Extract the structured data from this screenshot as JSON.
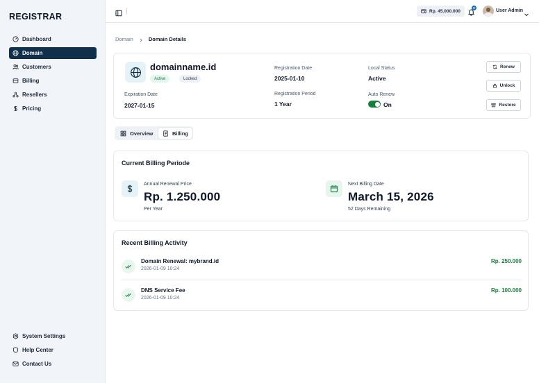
{
  "sidebar": {
    "brand": "REGISTRAR",
    "items": [
      {
        "label": "Dashboard",
        "icon": "gauge-icon"
      },
      {
        "label": "Domain",
        "icon": "globe-icon",
        "active": true
      },
      {
        "label": "Customers",
        "icon": "users-icon"
      },
      {
        "label": "Billing",
        "icon": "receipt-icon"
      },
      {
        "label": "Resellers",
        "icon": "network-icon"
      },
      {
        "label": "Pricing",
        "icon": "dollar-icon"
      }
    ],
    "bottom_items": [
      {
        "label": "System Settings",
        "icon": "gear-icon"
      },
      {
        "label": "Help Center",
        "icon": "shield-icon"
      },
      {
        "label": "Contact Us",
        "icon": "mail-icon"
      }
    ]
  },
  "topbar": {
    "balance": "Rp. 45.000.000",
    "notification_count": "0",
    "user_name": "User Admin"
  },
  "breadcrumb": {
    "parent": "Domain",
    "current": "Domain Details"
  },
  "domain": {
    "name": "domainname.id",
    "badges": [
      "Active",
      "Locked"
    ],
    "expiration_label": "Expiration Date",
    "expiration_value": "2027-01-15",
    "registration_date_label": "Registration Date",
    "registration_date_value": "2025-01-10",
    "registration_period_label": "Registration Period",
    "registration_period_value": "1 Year",
    "local_status_label": "Local Status",
    "local_status_value": "Active",
    "auto_renew_label": "Auto Renew",
    "auto_renew_value": "On",
    "actions": {
      "renew": "Renew",
      "unlock": "Unlock",
      "restore": "Restore"
    }
  },
  "tabs": [
    {
      "label": "Overview",
      "active": false
    },
    {
      "label": "Billing",
      "active": true
    }
  ],
  "billing_period": {
    "title": "Current Billing Periode",
    "renewal_label": "Annual Renewal Price",
    "renewal_value": "Rp. 1.250.000",
    "renewal_sub": "Per Year",
    "next_label": "Next Billing Date",
    "next_value": "March 15, 2026",
    "next_sub": "52 Days Remaining"
  },
  "activity": {
    "title": "Recent Billing Activity",
    "items": [
      {
        "title": "Domain Renewal: mybrand.id",
        "date": "2026-01-09 10:24",
        "amount": "Rp. 250.000"
      },
      {
        "title": "DNS Service Fee",
        "date": "2026-01-09 10:24",
        "amount": "Rp. 100.000"
      }
    ]
  },
  "colors": {
    "sidebar_active": "#0f2f4a",
    "success": "#15803d",
    "accent_bg": "#e5f2f8"
  }
}
